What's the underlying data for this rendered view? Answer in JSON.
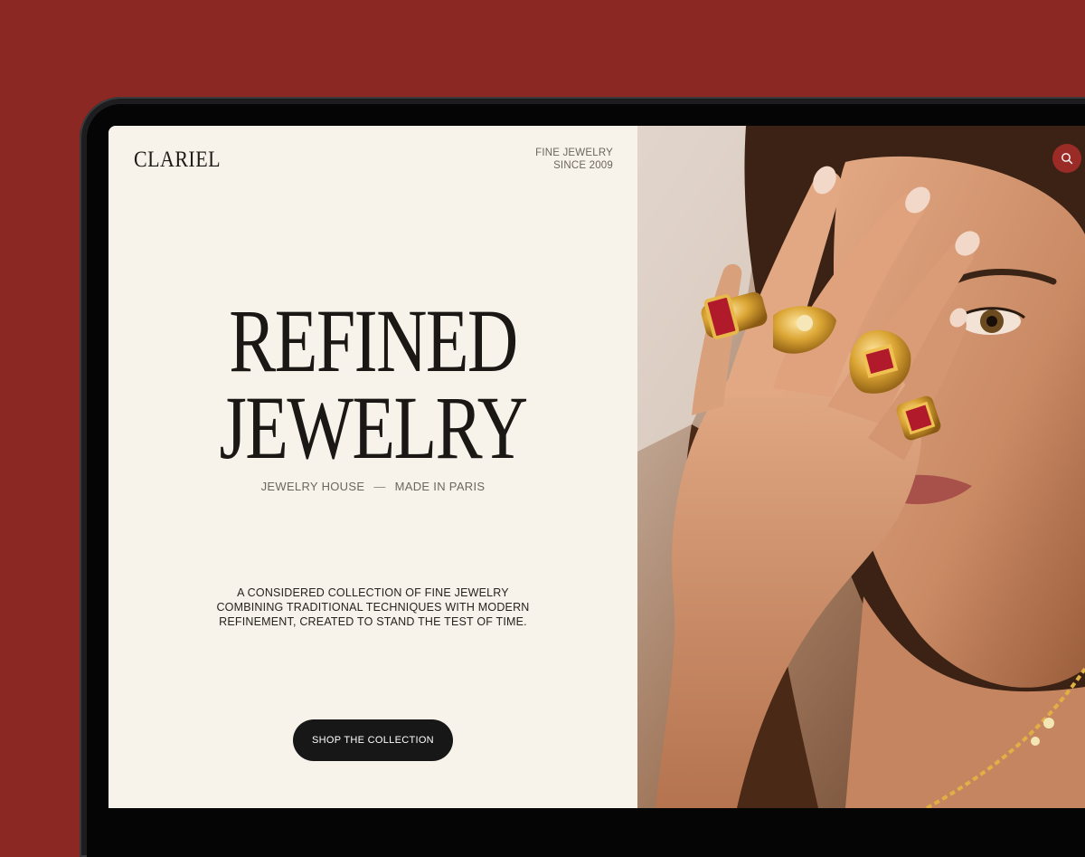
{
  "brand": {
    "logo": "CLARIEL",
    "tagline_line1": "FINE JEWELRY",
    "tagline_line2": "SINCE 2009"
  },
  "hero": {
    "title_line1": "REFINED",
    "title_line2": "JEWELRY",
    "subtitle_left": "JEWELRY HOUSE",
    "subtitle_separator": "—",
    "subtitle_right": "MADE IN PARIS",
    "description": "A CONSIDERED COLLECTION OF FINE JEWELRY COMBINING TRADITIONAL TECHNIQUES WITH MODERN REFINEMENT, CREATED TO STAND THE TEST OF TIME.",
    "cta_label": "SHOP THE COLLECTION"
  },
  "icons": {
    "search": "search-icon"
  },
  "colors": {
    "background": "#8b2823",
    "panel": "#f7f3ea",
    "button": "#171717",
    "accent": "#9b2b27",
    "gem": "#b01a2a",
    "gold": "#d9a431"
  }
}
